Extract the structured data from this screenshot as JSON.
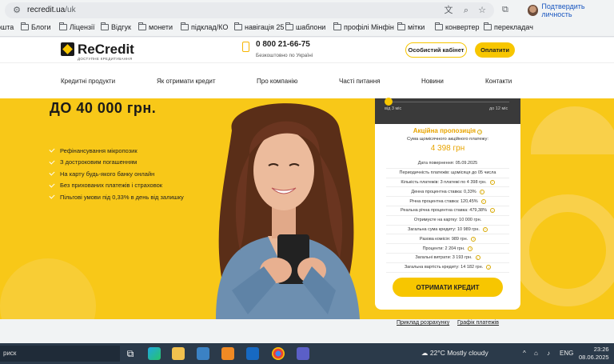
{
  "browser": {
    "url_domain": "recredit.ua",
    "url_path": "/uk",
    "profile_label": "Подтвердить личность",
    "bookmarks": [
      "ошта",
      "Блоги",
      "Ліцензії",
      "Відгук",
      "монети",
      "підклад/КО",
      "навігація 25",
      "шаблони",
      "профілі Мінфін",
      "мітки",
      "конвертер",
      "перекладач"
    ]
  },
  "site": {
    "logo_text": "ReCredit",
    "logo_tagline": "ДОСТУПНЕ КРЕДИТУВАННЯ",
    "phone": "0 800 21-66-75",
    "phone_note": "Безкоштовно по Україні",
    "cabinet_button": "Особистий кабінет",
    "pay_button": "Оплатити",
    "nav": [
      "Кредитні продукти",
      "Як отримати кредит",
      "Про компанію",
      "Часті питання",
      "Новини",
      "Контакти"
    ]
  },
  "hero": {
    "title": "ДО 40 000 грн.",
    "bullets": [
      "Рефінансування мікропозик",
      "З достроковим погашенням",
      "На карту будь-якого банку онлайн",
      "Без прихованих платежів і страховок",
      "Пільгові умови під 0,33% в день від залишку"
    ]
  },
  "calculator": {
    "slider_min_label": "від 3 міс",
    "slider_max_label": "до 12 міс",
    "promo_title": "Акційна пропозиція",
    "promo_subtitle": "Сума щомісячного акційного платежу:",
    "promo_amount": "4 398 грн",
    "rows": [
      "Дата повернення: 05.09.2025",
      "Периодичність платежів: щомісяця до 05 числа",
      "Кількість платежів: 3 платежі  по  4 398  грн.",
      "Денна процентна ставка: 0,33%",
      "Річна процентна ставка: 120,45%",
      "Реальна річна процентна ставка: 479,38%",
      "Отримуєте на картку: 10 000  грн.",
      "Загальна сума кредиту: 10 989  грн.",
      "Разова комісія: 989  грн.",
      "Проценти: 2 204  грн.",
      "Загальні витрати: 3 193  грн.",
      "Загальна вартість кредиту: 14 182  грн."
    ],
    "get_credit_button": "ОТРИМАТИ КРЕДИТ",
    "link_example": "Приклад розрахунку",
    "link_schedule": "Графік платежів"
  },
  "taskbar": {
    "search_label": "риск",
    "weather": "22°C  Mostly cloudy",
    "lang": "ENG",
    "time": "23:26",
    "date": "08.06.2025"
  },
  "colors": {
    "brand_yellow": "#f8c818",
    "accent_orange": "#e8a400",
    "dark": "#1a1a1a"
  }
}
